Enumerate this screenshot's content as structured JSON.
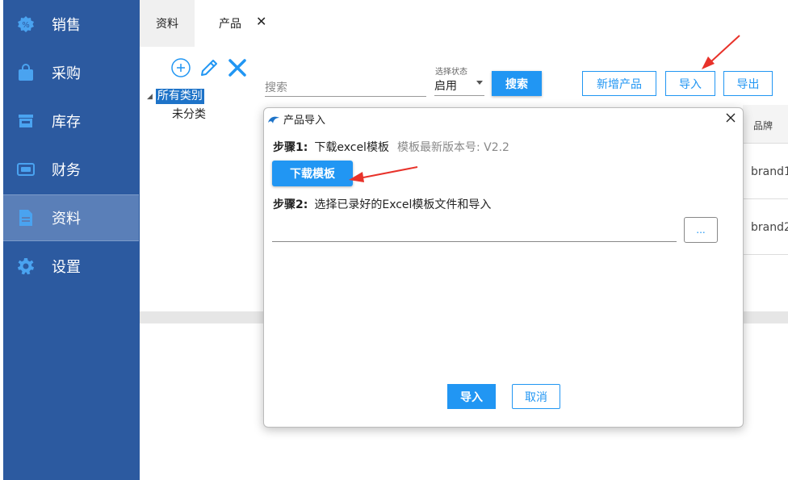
{
  "sidebar": {
    "items": [
      {
        "label": "销售",
        "icon": "sales-icon"
      },
      {
        "label": "采购",
        "icon": "shopping-bag-icon"
      },
      {
        "label": "库存",
        "icon": "store-icon"
      },
      {
        "label": "财务",
        "icon": "finance-icon"
      },
      {
        "label": "资料",
        "icon": "document-icon",
        "active": true
      },
      {
        "label": "设置",
        "icon": "gear-icon"
      }
    ]
  },
  "tabs": [
    {
      "label": "资料"
    },
    {
      "label": "产品"
    }
  ],
  "tab_close": "✕",
  "tree": {
    "root": "所有类别",
    "children": [
      "未分类"
    ]
  },
  "search": {
    "placeholder": "搜索",
    "status_label": "选择状态",
    "status_value": "启用",
    "search_button": "搜索"
  },
  "toolbar": {
    "new_product": "新增产品",
    "import": "导入",
    "export": "导出"
  },
  "table": {
    "header": "品牌",
    "rows": [
      "brand1",
      "brand2"
    ]
  },
  "dialog": {
    "title": "产品导入",
    "step1_key": "步骤1:",
    "step1_text": "下载excel模板",
    "step1_version": "模板最新版本号: V2.2",
    "download_button": "下载模板",
    "step2_key": "步骤2:",
    "step2_text": "选择已录好的Excel模板文件和导入",
    "browse_button": "...",
    "ok_button": "导入",
    "cancel_button": "取消"
  },
  "colors": {
    "sidebar": "#2c5aa0",
    "primary": "#2196f3",
    "annotation": "#e8322a"
  }
}
